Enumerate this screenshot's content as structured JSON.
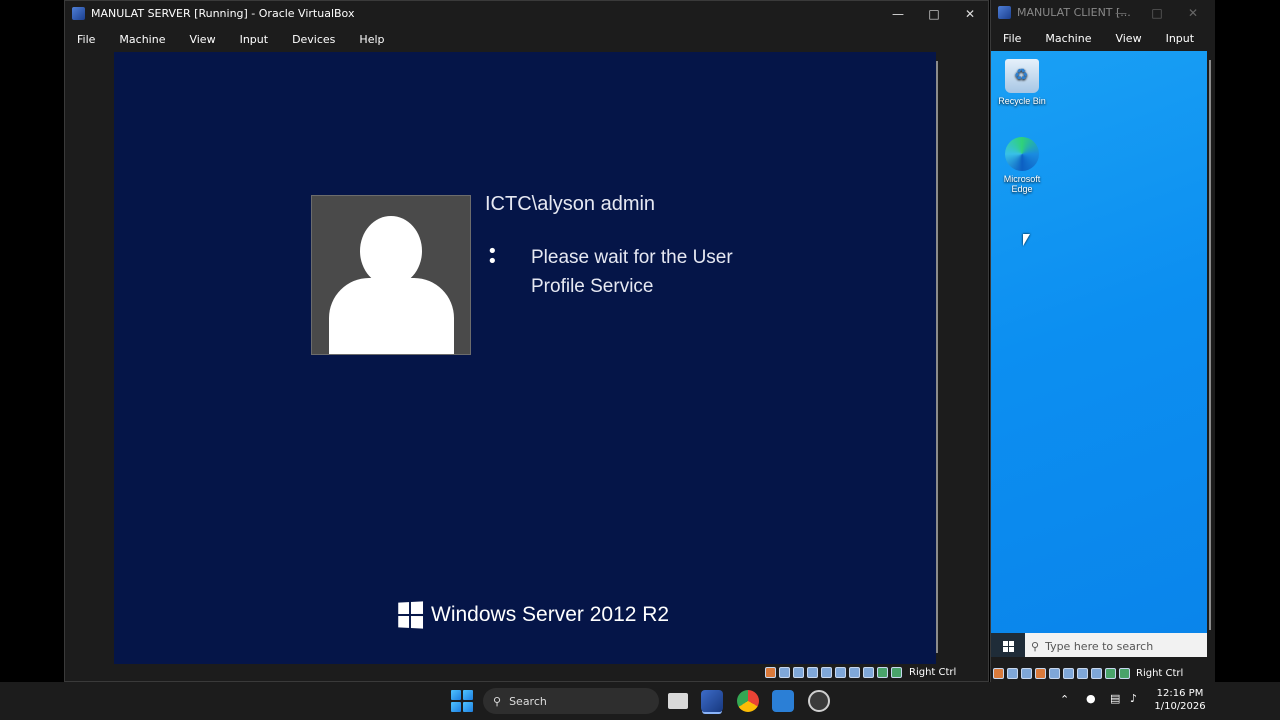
{
  "server_window": {
    "title": "MANULAT SERVER [Running] - Oracle VirtualBox",
    "menu": [
      "File",
      "Machine",
      "View",
      "Input",
      "Devices",
      "Help"
    ],
    "login": {
      "username": "ICTC\\alyson admin",
      "status_message": "Please wait for the User Profile Service",
      "brand": "Windows Server 2012 R2"
    },
    "host_key": "Right Ctrl"
  },
  "client_window": {
    "title": "MANULAT CLIENT [...",
    "menu": [
      "File",
      "Machine",
      "View",
      "Input"
    ],
    "desktop_icons": [
      {
        "label": "Recycle Bin",
        "icon": "recycle-bin-icon"
      },
      {
        "label": "Microsoft Edge",
        "icon": "edge-icon"
      }
    ],
    "search_placeholder": "Type here to search",
    "host_key": "Right Ctrl"
  },
  "host_taskbar": {
    "search_label": "Search",
    "apps": [
      "task-view-icon",
      "virtualbox-icon",
      "chrome-icon",
      "visual-studio-icon",
      "obs-icon"
    ],
    "time": "12:16 PM",
    "date": "1/10/2026"
  },
  "colors": {
    "server_background": "#051548",
    "client_desktop": "#0c8ff1",
    "taskbar": "#1c1c1c"
  }
}
